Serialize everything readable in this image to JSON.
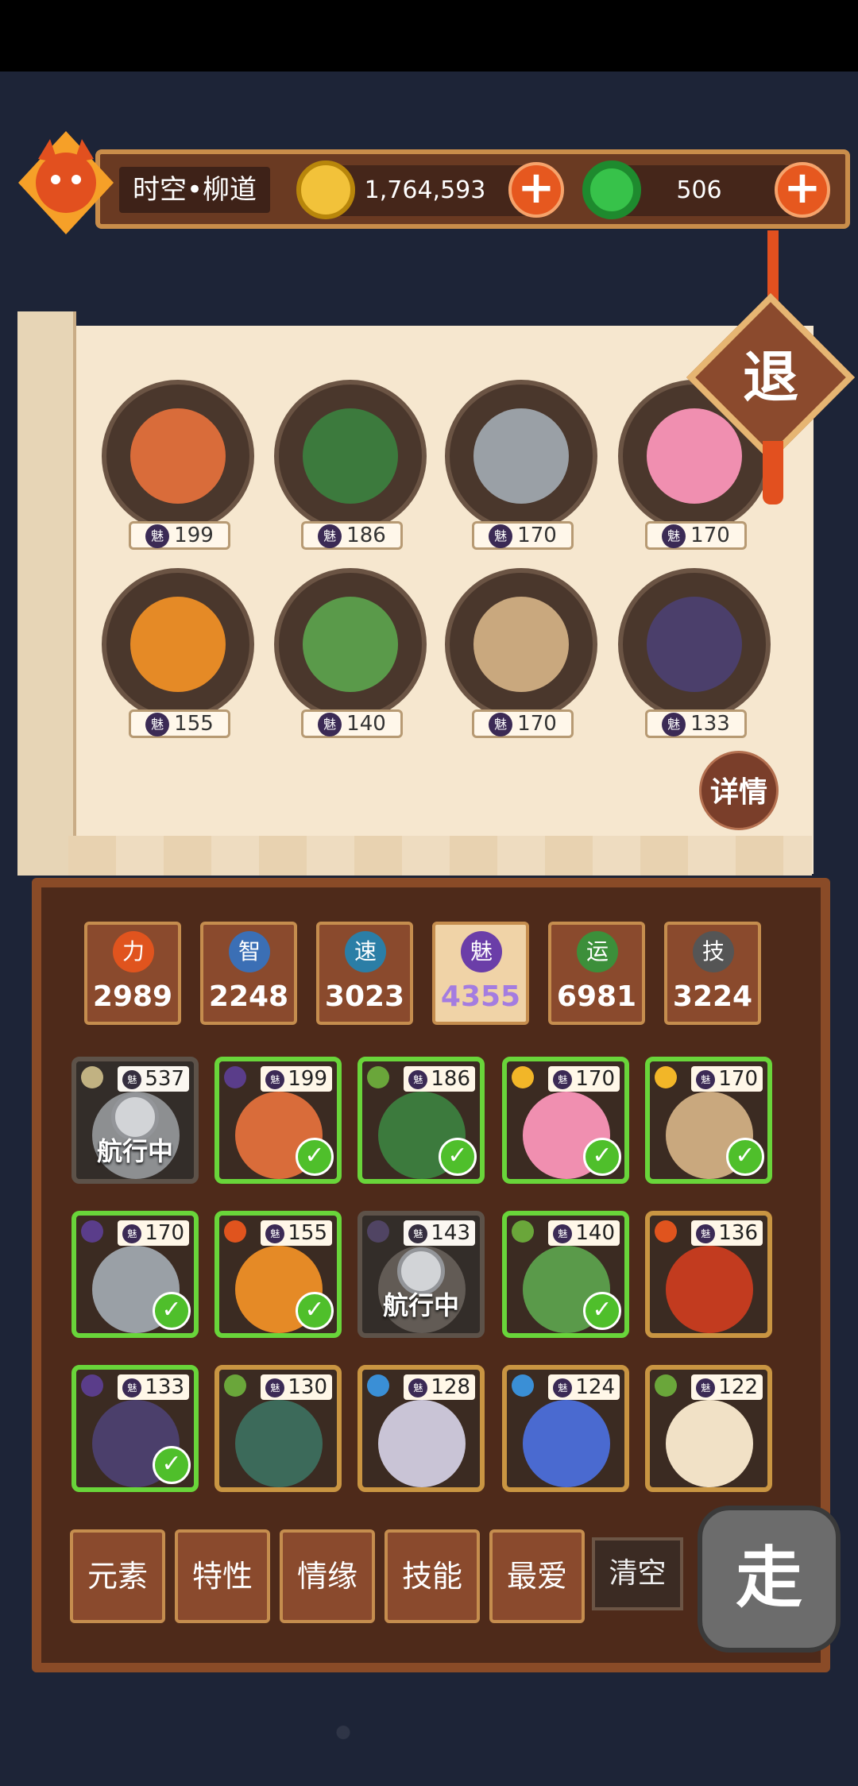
{
  "player": {
    "location": "时空•柳道"
  },
  "resources": {
    "coins": "1,764,593",
    "jade": "506"
  },
  "selected_heroes": [
    {
      "charm": "199",
      "color": "#d96c3a"
    },
    {
      "charm": "186",
      "color": "#3c7a3d"
    },
    {
      "charm": "170",
      "color": "#9aa0a6"
    },
    {
      "charm": "170",
      "color": "#f08fb0"
    },
    {
      "charm": "155",
      "color": "#e58a26"
    },
    {
      "charm": "140",
      "color": "#5a9a4a"
    },
    {
      "charm": "170",
      "color": "#c9a87e"
    },
    {
      "charm": "133",
      "color": "#4b3f6b"
    }
  ],
  "buttons": {
    "exit": "退",
    "detail": "详情",
    "clear": "清空",
    "go": "走"
  },
  "stats": [
    {
      "icon": "力",
      "value": "2989",
      "color": "#e0541e"
    },
    {
      "icon": "智",
      "value": "2248",
      "color": "#3b6fb5"
    },
    {
      "icon": "速",
      "value": "3023",
      "color": "#2b7ea6"
    },
    {
      "icon": "魅",
      "value": "4355",
      "color": "#6b3ea8"
    },
    {
      "icon": "运",
      "value": "6981",
      "color": "#3c8f3a"
    },
    {
      "icon": "技",
      "value": "3224",
      "color": "#555"
    }
  ],
  "charm_icon": "魅",
  "roster": [
    {
      "charm": "537",
      "status": "航行中",
      "state": "busy",
      "element": "#d9b23a",
      "color": "#8a8f96"
    },
    {
      "charm": "199",
      "status": "",
      "state": "sel",
      "element": "#5a3d8a",
      "color": "#d96c3a"
    },
    {
      "charm": "186",
      "status": "",
      "state": "sel",
      "element": "#6aa63a",
      "color": "#3c7a3d"
    },
    {
      "charm": "170",
      "status": "",
      "state": "sel",
      "element": "#f2b628",
      "color": "#f08fb0"
    },
    {
      "charm": "170",
      "status": "",
      "state": "sel",
      "element": "#f2b628",
      "color": "#c9a87e"
    },
    {
      "charm": "170",
      "status": "",
      "state": "sel",
      "element": "#5a3d8a",
      "color": "#9aa0a6"
    },
    {
      "charm": "155",
      "status": "",
      "state": "sel",
      "element": "#e0541e",
      "color": "#e58a26"
    },
    {
      "charm": "143",
      "status": "航行中",
      "state": "busy",
      "element": "#5a3d8a",
      "color": "#6a5a4a"
    },
    {
      "charm": "140",
      "status": "",
      "state": "sel",
      "element": "#6aa63a",
      "color": "#5a9a4a"
    },
    {
      "charm": "136",
      "status": "",
      "state": "",
      "element": "#e0541e",
      "color": "#c23b1f"
    },
    {
      "charm": "133",
      "status": "",
      "state": "sel",
      "element": "#5a3d8a",
      "color": "#4b3f6b"
    },
    {
      "charm": "130",
      "status": "",
      "state": "",
      "element": "#6aa63a",
      "color": "#3c6a5a"
    },
    {
      "charm": "128",
      "status": "",
      "state": "",
      "element": "#3a8fd6",
      "color": "#c9c4d6"
    },
    {
      "charm": "124",
      "status": "",
      "state": "",
      "element": "#3a8fd6",
      "color": "#4a6ad0"
    },
    {
      "charm": "122",
      "status": "",
      "state": "",
      "element": "#6aa63a",
      "color": "#f1e1c6"
    }
  ],
  "filters": [
    "元素",
    "特性",
    "情缘",
    "技能",
    "最爱"
  ]
}
